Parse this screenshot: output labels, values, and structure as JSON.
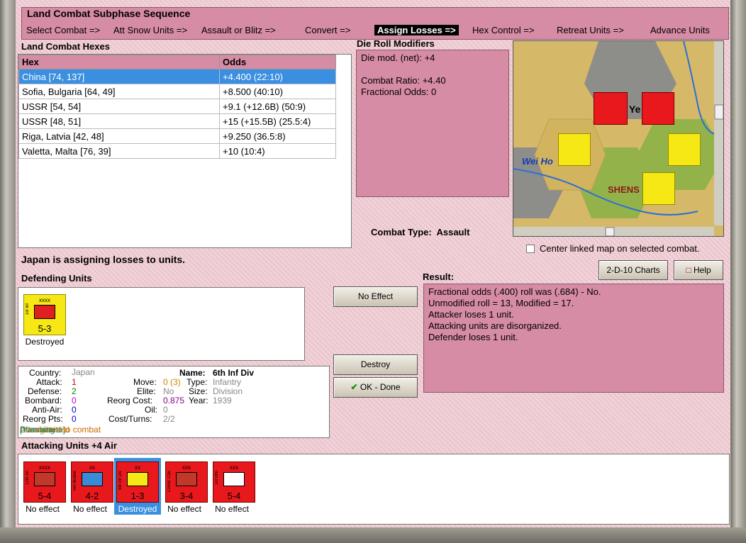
{
  "sequence": {
    "title": "Land Combat Subphase Sequence",
    "items": [
      "Select Combat =>",
      "Att Snow Units =>",
      "Assault or Blitz =>",
      "Convert =>",
      "Assign Losses =>",
      "Hex Control =>",
      "Retreat Units =>",
      "Advance Units"
    ],
    "active_index": 4
  },
  "hexes": {
    "title": "Land Combat Hexes",
    "col_hex": "Hex",
    "col_odds": "Odds",
    "rows": [
      {
        "hex": "China [74, 137]",
        "odds": "+4.400 (22:10)",
        "selected": true
      },
      {
        "hex": "Sofia, Bulgaria [64, 49]",
        "odds": "+8.500 (40:10)"
      },
      {
        "hex": "USSR [54, 54]",
        "odds": "+9.1 (+12.6B) (50:9)"
      },
      {
        "hex": "USSR [48, 51]",
        "odds": "+15 (+15.5B) (25.5:4)"
      },
      {
        "hex": "Riga, Latvia [42, 48]",
        "odds": "+9.250 (36.5:8)"
      },
      {
        "hex": "Valetta, Malta [76, 39]",
        "odds": "+10 (10:4)"
      }
    ]
  },
  "modifiers": {
    "title": "Die Roll Modifiers",
    "line1": "Die mod. (net): +4",
    "line2": "Combat Ratio: +4.40",
    "line3": "Fractional Odds: 0"
  },
  "combat_type": {
    "label": "Combat Type:",
    "value": "Assault"
  },
  "center_map_label": "Center linked map on selected combat.",
  "map": {
    "river_label": "Wei Ho",
    "region_label": "SHENS",
    "city_label": "Ye"
  },
  "status": "Japan is assigning losses to units.",
  "defending": {
    "title": "Defending Units",
    "units": [
      {
        "name": "1st Inf",
        "size": "xxxx",
        "value": "5-3",
        "caption": "Destroyed"
      }
    ]
  },
  "buttons": {
    "no_effect": "No Effect",
    "destroy": "Destroy",
    "ok_done": "OK - Done",
    "charts": "2-D-10 Charts",
    "help": "Help"
  },
  "result": {
    "title": "Result:",
    "lines": [
      "Fractional odds (.400) roll was (.684)  - No.",
      "Unmodified roll = 13, Modified = 17.",
      "Attacker loses 1 unit.",
      "Attacking units are disorganized.",
      "Defender loses 1 unit."
    ]
  },
  "info": {
    "country_k": "Country:",
    "country_v": "Japan",
    "attack_k": "Attack:",
    "attack_v": "1",
    "defense_k": "Defense:",
    "defense_v": "2",
    "bombard_k": "Bombard:",
    "bombard_v": "0",
    "antiair_k": "Anti-Air:",
    "antiair_v": "0",
    "reorg_k": "Reorg Pts:",
    "reorg_v": "0",
    "move_k": "Move:",
    "move_v": "0 (3)",
    "elite_k": "Elite:",
    "elite_v": "No",
    "reorgcost_k": "Reorg Cost:",
    "reorgcost_v": "0.875",
    "oil_k": "Oil:",
    "oil_v": "0",
    "cost_k": "Cost/Turns:",
    "cost_v": "2/2",
    "name_k": "Name:",
    "name_v": "6th Inf Div",
    "type_k": "Type:",
    "type_v": "Infantry",
    "size_k": "Size:",
    "size_v": "Division",
    "year_k": "Year:",
    "year_v": "1939",
    "tag1": "Attacking",
    "tag2": "Disorganized",
    "tag3": "[Yamamoto]",
    "tag4": "Committed to combat"
  },
  "attacking": {
    "title": "Attacking Units +4 Air",
    "units": [
      {
        "name": "12th Inf",
        "size": "xxxx",
        "value": "5-4",
        "caption": "No effect"
      },
      {
        "name": "Ten Mobile",
        "size": "xx",
        "value": "4-2",
        "caption": "No effect"
      },
      {
        "name": "6th Inf Div",
        "size": "xx",
        "value": "1-3",
        "caption": "Destroyed",
        "selected": true
      },
      {
        "name": "Comb. Cav",
        "size": "xxx",
        "value": "3-4",
        "caption": "No effect"
      },
      {
        "name": "1st Mtn",
        "size": "xxx",
        "value": "5-4",
        "caption": "No effect"
      }
    ]
  }
}
